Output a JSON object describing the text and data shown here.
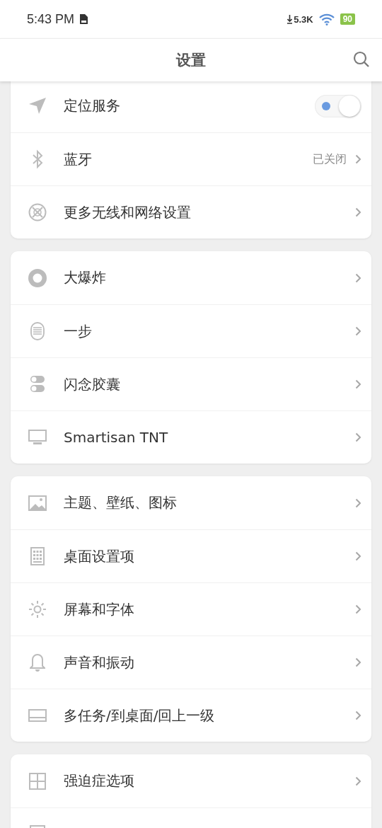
{
  "status_bar": {
    "time": "5:43 PM",
    "network_speed": "5.3K",
    "battery": "90"
  },
  "header": {
    "title": "设置"
  },
  "groups": [
    {
      "items": [
        {
          "kind": "toggle",
          "label": "定位服务",
          "on": true
        },
        {
          "kind": "link",
          "label": "蓝牙",
          "value": "已关闭"
        },
        {
          "kind": "link",
          "label": "更多无线和网络设置"
        }
      ]
    },
    {
      "items": [
        {
          "kind": "link",
          "label": "大爆炸"
        },
        {
          "kind": "link",
          "label": "一步"
        },
        {
          "kind": "link",
          "label": "闪念胶囊"
        },
        {
          "kind": "link",
          "label": "Smartisan TNT"
        }
      ]
    },
    {
      "items": [
        {
          "kind": "link",
          "label": "主题、壁纸、图标"
        },
        {
          "kind": "link",
          "label": "桌面设置项"
        },
        {
          "kind": "link",
          "label": "屏幕和字体"
        },
        {
          "kind": "link",
          "label": "声音和振动"
        },
        {
          "kind": "link",
          "label": "多任务/到桌面/回上一级"
        }
      ]
    },
    {
      "items": [
        {
          "kind": "link",
          "label": "强迫症选项"
        },
        {
          "kind": "partial"
        }
      ]
    }
  ]
}
